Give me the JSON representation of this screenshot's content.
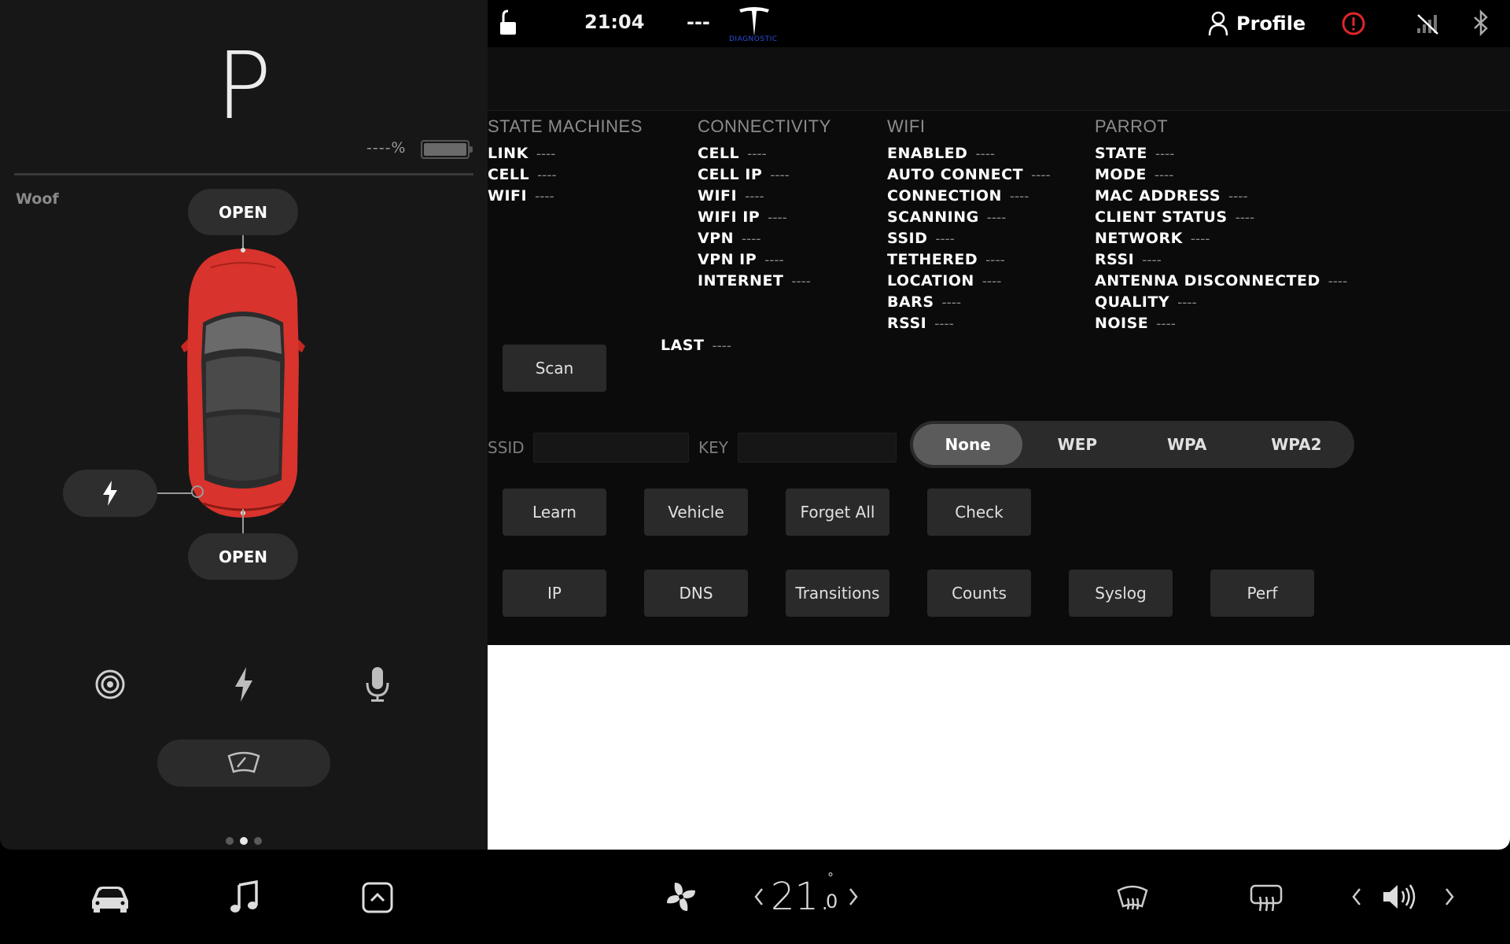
{
  "left_panel": {
    "gear": "P",
    "battery_text": "----%",
    "car_name": "Woof",
    "frunk_label": "OPEN",
    "trunk_label": "OPEN",
    "icons": [
      "camera-icon",
      "lightning-icon",
      "microphone-icon",
      "wiper-icon"
    ],
    "page_dots": 3,
    "active_page": 1
  },
  "status_bar": {
    "time": "21:04",
    "temp_outside": "---",
    "diagnostic_label": "DIAGNOSTIC",
    "profile_label": "Profile",
    "icons": [
      "lock-icon",
      "tesla-logo",
      "profile-icon",
      "alert-icon",
      "no-signal-icon",
      "bluetooth-icon"
    ]
  },
  "diagnostics": {
    "columns": [
      {
        "title": "STATE MACHINES",
        "rows": [
          {
            "k": "LINK",
            "v": "----"
          },
          {
            "k": "CELL",
            "v": "----"
          },
          {
            "k": "WIFI",
            "v": "----"
          }
        ]
      },
      {
        "title": "CONNECTIVITY",
        "rows": [
          {
            "k": "CELL",
            "v": "----"
          },
          {
            "k": "CELL IP",
            "v": "----"
          },
          {
            "k": "WIFI",
            "v": "----"
          },
          {
            "k": "WIFI IP",
            "v": "----"
          },
          {
            "k": "VPN",
            "v": "----"
          },
          {
            "k": "VPN IP",
            "v": "----"
          },
          {
            "k": "INTERNET",
            "v": "----"
          }
        ]
      },
      {
        "title": "WIFI",
        "rows": [
          {
            "k": "ENABLED",
            "v": "----"
          },
          {
            "k": "AUTO CONNECT",
            "v": "----"
          },
          {
            "k": "CONNECTION",
            "v": "----"
          },
          {
            "k": "SCANNING",
            "v": "----"
          },
          {
            "k": "SSID",
            "v": "----"
          },
          {
            "k": "TETHERED",
            "v": "----"
          },
          {
            "k": "LOCATION",
            "v": "----"
          },
          {
            "k": "BARS",
            "v": "----"
          },
          {
            "k": "RSSI",
            "v": "----"
          }
        ]
      },
      {
        "title": "PARROT",
        "rows": [
          {
            "k": "STATE",
            "v": "----"
          },
          {
            "k": "MODE",
            "v": "----"
          },
          {
            "k": "MAC ADDRESS",
            "v": "----"
          },
          {
            "k": "CLIENT STATUS",
            "v": "----"
          },
          {
            "k": "NETWORK",
            "v": "----"
          },
          {
            "k": "RSSI",
            "v": "----"
          },
          {
            "k": "ANTENNA DISCONNECTED",
            "v": "----"
          },
          {
            "k": "QUALITY",
            "v": "----"
          },
          {
            "k": "NOISE",
            "v": "----"
          }
        ]
      }
    ],
    "last": {
      "k": "LAST",
      "v": "----"
    },
    "scan_button": "Scan",
    "ssid_label": "SSID",
    "ssid_value": "",
    "key_label": "KEY",
    "key_value": "",
    "security_options": [
      "None",
      "WEP",
      "WPA",
      "WPA2"
    ],
    "security_selected": "None",
    "buttons_row1": [
      "Learn",
      "Vehicle",
      "Forget All",
      "Check"
    ],
    "buttons_row2": [
      "IP",
      "DNS",
      "Transitions",
      "Counts",
      "Syslog",
      "Perf"
    ]
  },
  "bottom_bar": {
    "temperature_whole": "21.",
    "temperature_decimal": "0",
    "temperature_degree": "°",
    "icons": [
      "car-icon",
      "music-note-icon",
      "app-launcher-icon",
      "fan-icon",
      "chevron-left-icon",
      "chevron-right-icon",
      "front-defrost-icon",
      "rear-defrost-icon",
      "volume-down-icon",
      "speaker-icon",
      "volume-up-icon"
    ]
  },
  "colors": {
    "background": "#000000",
    "panel": "#171717",
    "button": "#2a2a2a",
    "selected_segment": "#5b5b5b",
    "car_red": "#d8332c",
    "alert_red": "#e0262b",
    "diagnostic_blue": "#2a4fe0"
  }
}
